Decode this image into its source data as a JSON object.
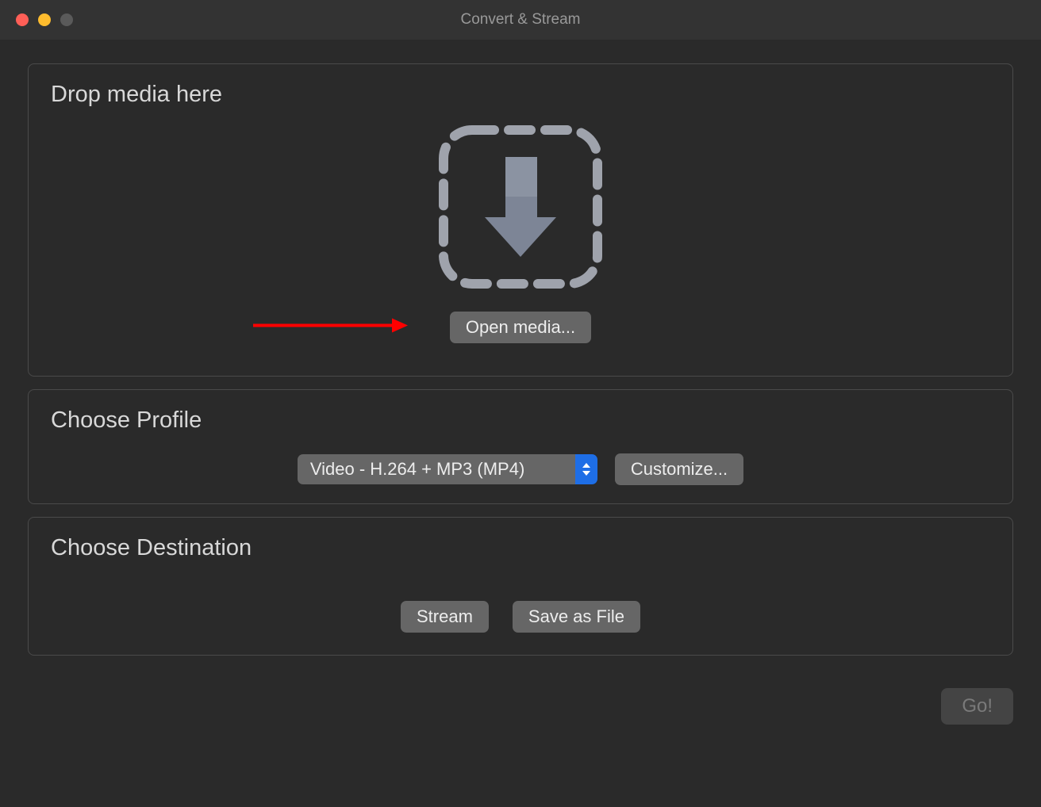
{
  "window": {
    "title": "Convert & Stream"
  },
  "drop": {
    "title": "Drop media here",
    "open_button": "Open media..."
  },
  "profile": {
    "title": "Choose Profile",
    "selected": "Video - H.264 + MP3 (MP4)",
    "customize_button": "Customize..."
  },
  "destination": {
    "title": "Choose Destination",
    "stream_button": "Stream",
    "save_button": "Save as File"
  },
  "footer": {
    "go_button": "Go!"
  }
}
